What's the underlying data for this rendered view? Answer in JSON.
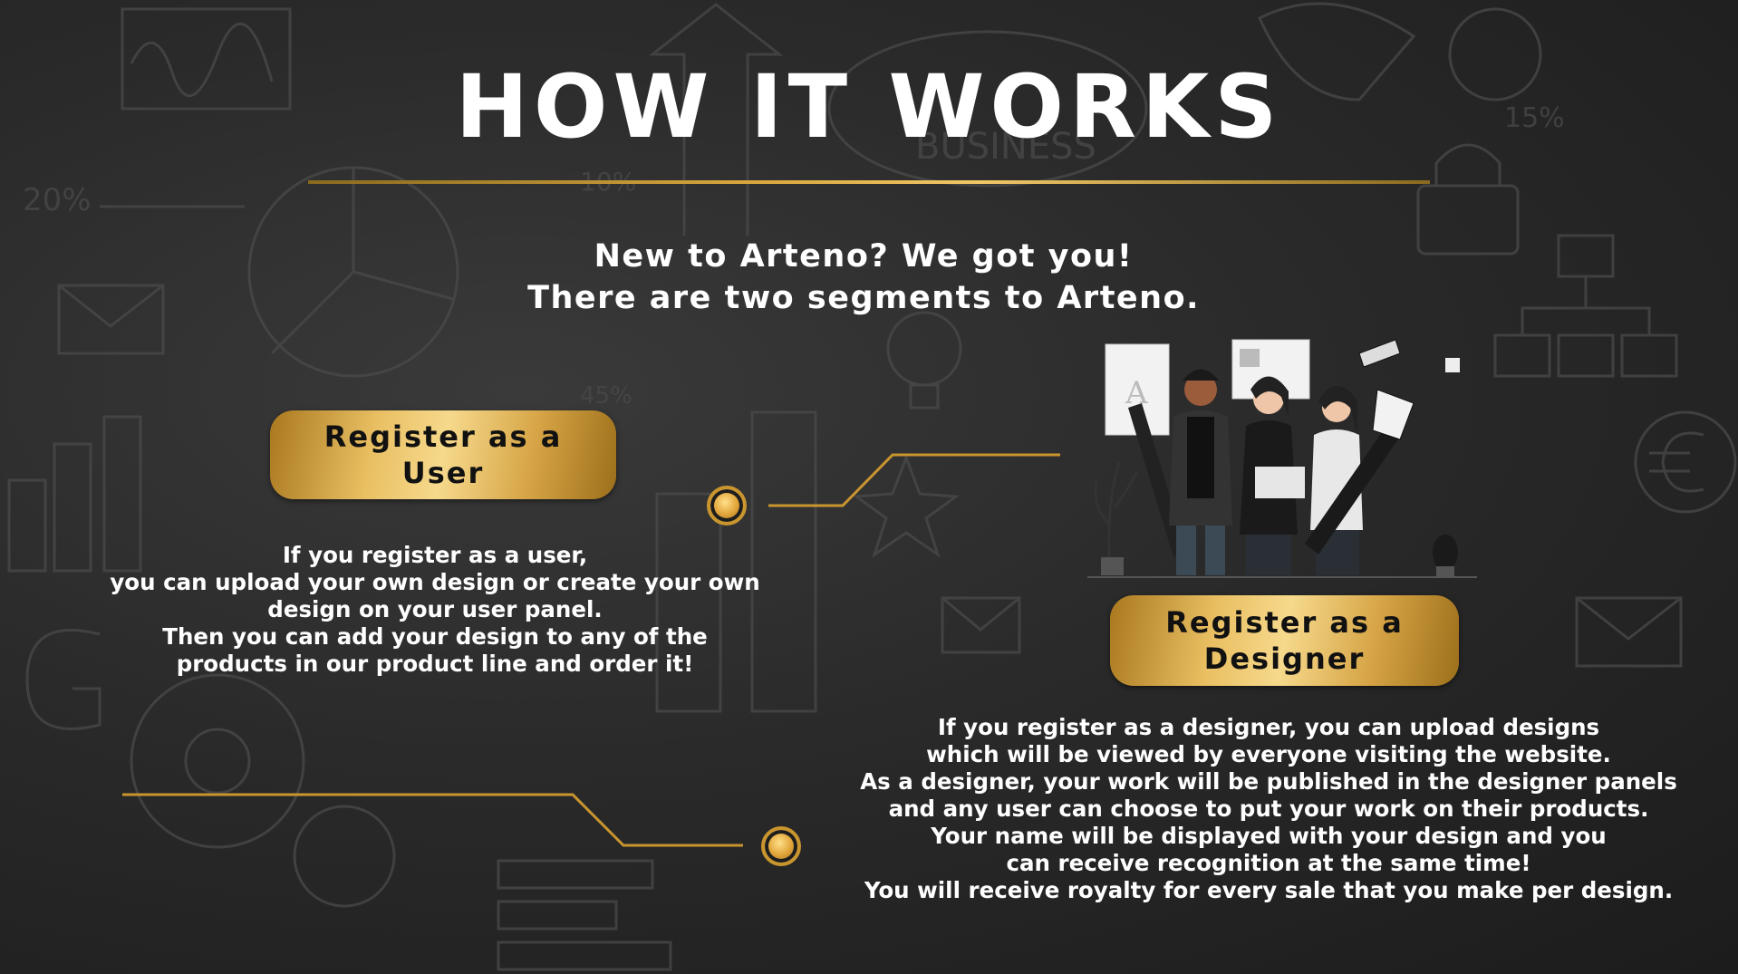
{
  "page": {
    "title": "HOW IT WORKS",
    "intro": {
      "line1": "New to Arteno? We got you!",
      "line2": "There are two segments to Arteno."
    }
  },
  "user_segment": {
    "button_line1": "Register as a",
    "button_line2": "User",
    "description": [
      "If you register as a user,",
      "you can upload your own design or create your own",
      "design on your user panel.",
      "Then you can add your design to any of the",
      "products in our product line and order it!"
    ]
  },
  "designer_segment": {
    "button_line1": "Register as a",
    "button_line2": "Designer",
    "description": [
      "If you register as a designer, you can upload designs",
      "which will be viewed by everyone visiting the website.",
      "As a designer, your work will be published in the designer panels",
      "and any user can choose to put your work on their products.",
      "Your name will be displayed with your design and you",
      "can receive recognition at the same time!",
      "You will receive royalty for every sale that you make per design."
    ]
  },
  "background_doodles": {
    "percent_1": "20%",
    "percent_2": "10%",
    "percent_3": "45%",
    "percent_4": "15%",
    "ellipse_word": "BUSINESS"
  },
  "illustration": {
    "card_letter": "A"
  },
  "colors": {
    "gold": "#d9a73d",
    "gold_light": "#f6d98c",
    "background": "#2a2a2a",
    "text": "#ffffff"
  },
  "icons": [
    "envelope-icon",
    "lightbulb-icon",
    "padlock-icon",
    "rocket-icon",
    "gear-icon",
    "euro-icon",
    "thumbs-up-icon",
    "color-palette-icon",
    "pie-chart-icon",
    "bar-chart-icon"
  ]
}
